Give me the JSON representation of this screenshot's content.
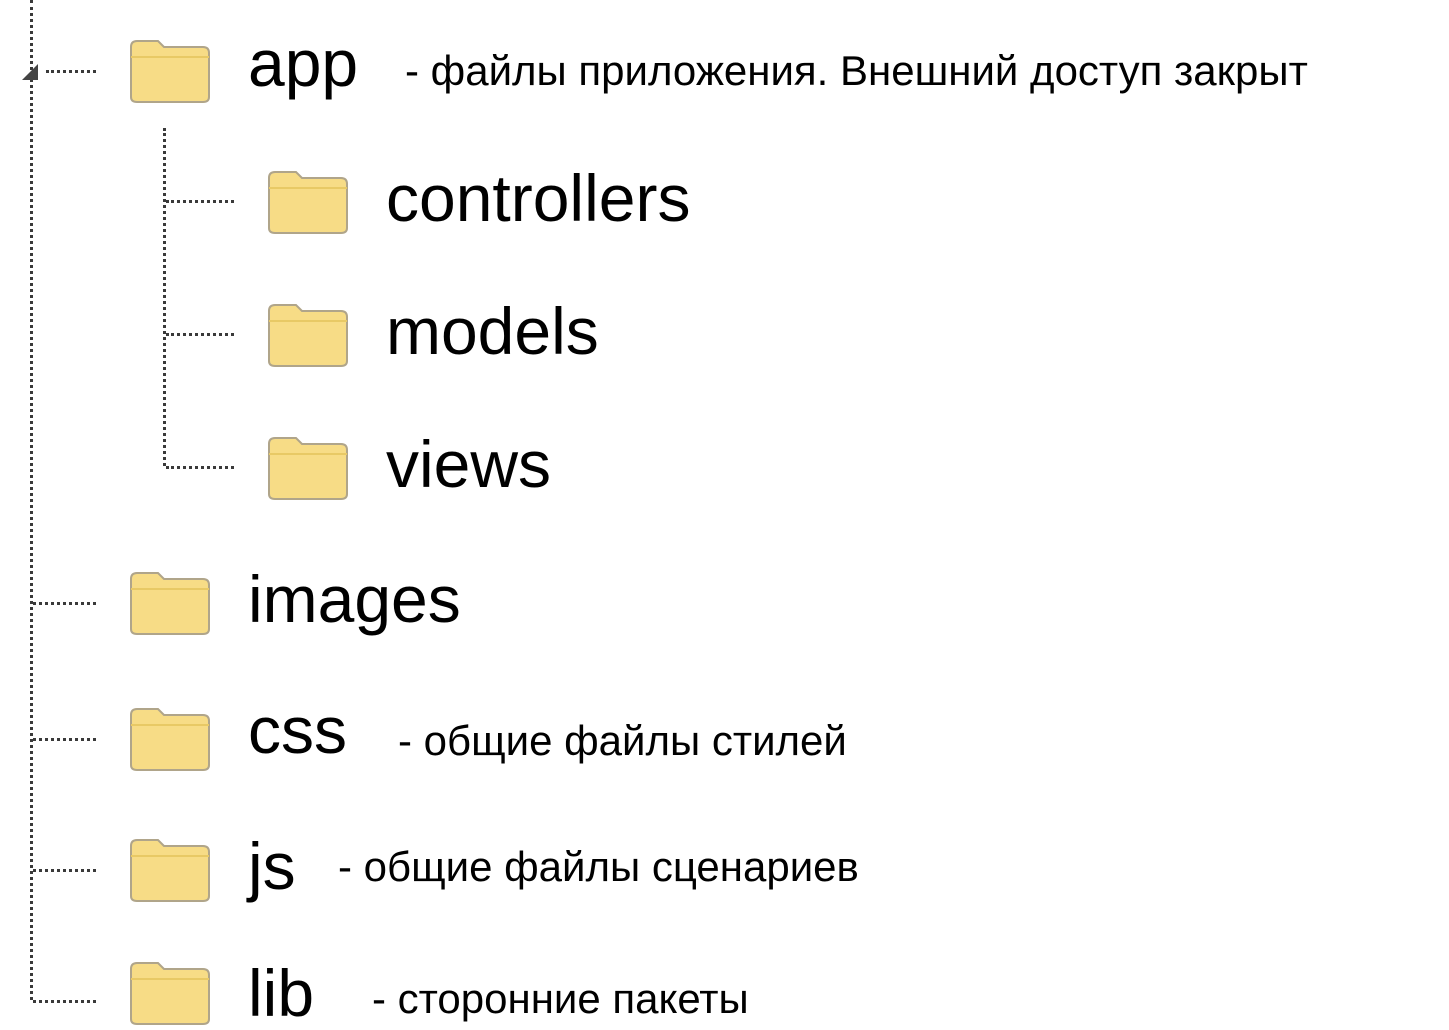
{
  "tree": {
    "items": [
      {
        "icon": "folder-icon",
        "name": "app",
        "note": "- файлы приложения. Внешний доступ закрыт"
      },
      {
        "icon": "folder-icon",
        "name": "controllers",
        "note": ""
      },
      {
        "icon": "folder-icon",
        "name": "models",
        "note": ""
      },
      {
        "icon": "folder-icon",
        "name": "views",
        "note": ""
      },
      {
        "icon": "folder-icon",
        "name": "images",
        "note": ""
      },
      {
        "icon": "folder-icon",
        "name": "css",
        "note": "- общие файлы стилей"
      },
      {
        "icon": "folder-icon",
        "name": "js",
        "note": "- общие файлы сценариев"
      },
      {
        "icon": "folder-icon",
        "name": "lib",
        "note": "- сторонние пакеты"
      }
    ]
  },
  "colors": {
    "folder_fill": "#f7dc86",
    "folder_stroke": "#b0a58a",
    "connector": "#3a3a3a"
  }
}
